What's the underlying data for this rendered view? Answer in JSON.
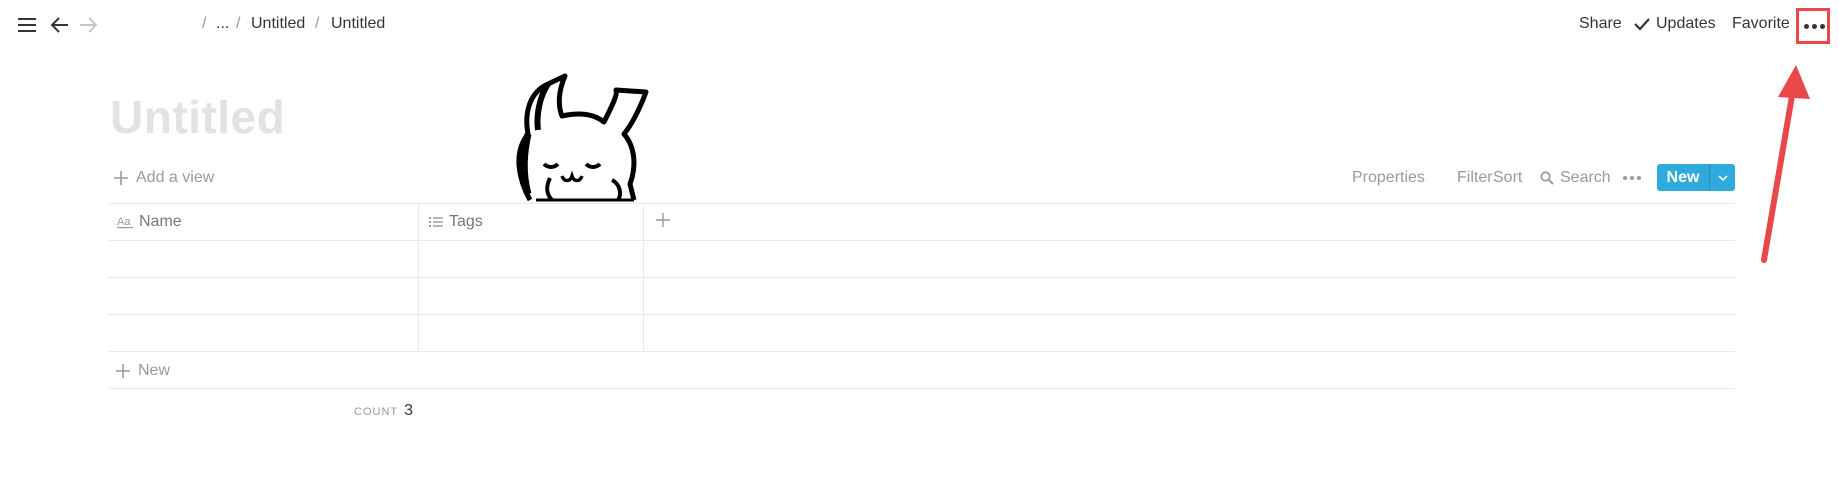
{
  "topbar": {
    "breadcrumb": {
      "sep1": "/",
      "ellipsis": "...",
      "sep2": "/",
      "crumb1": "Untitled",
      "sep3": "/",
      "crumb2": "Untitled"
    },
    "share_label": "Share",
    "updates_label": "Updates",
    "favorite_label": "Favorite",
    "icons": [
      "menu-icon",
      "back-arrow-icon",
      "forward-arrow-icon",
      "check-icon",
      "more-horizontal-icon"
    ]
  },
  "page": {
    "title": "Untitled"
  },
  "view_bar": {
    "add_view_label": "Add a view",
    "properties_label": "Properties",
    "filter_label": "Filter",
    "sort_label": "Sort",
    "search_label": "Search",
    "new_label": "New"
  },
  "table": {
    "columns": [
      {
        "label": "Name",
        "icon": "text-property-icon"
      },
      {
        "label": "Tags",
        "icon": "list-property-icon"
      }
    ],
    "rows": [
      {
        "name": "",
        "tags": ""
      },
      {
        "name": "",
        "tags": ""
      },
      {
        "name": "",
        "tags": ""
      }
    ],
    "new_row_label": "New",
    "count_label": "COUNT",
    "count_value": "3"
  },
  "colors": {
    "accent_blue": "#2eaadc",
    "annotation_red": "#e8484a",
    "muted_text": "#9b9a97",
    "title_placeholder": "#e3e2e0"
  }
}
